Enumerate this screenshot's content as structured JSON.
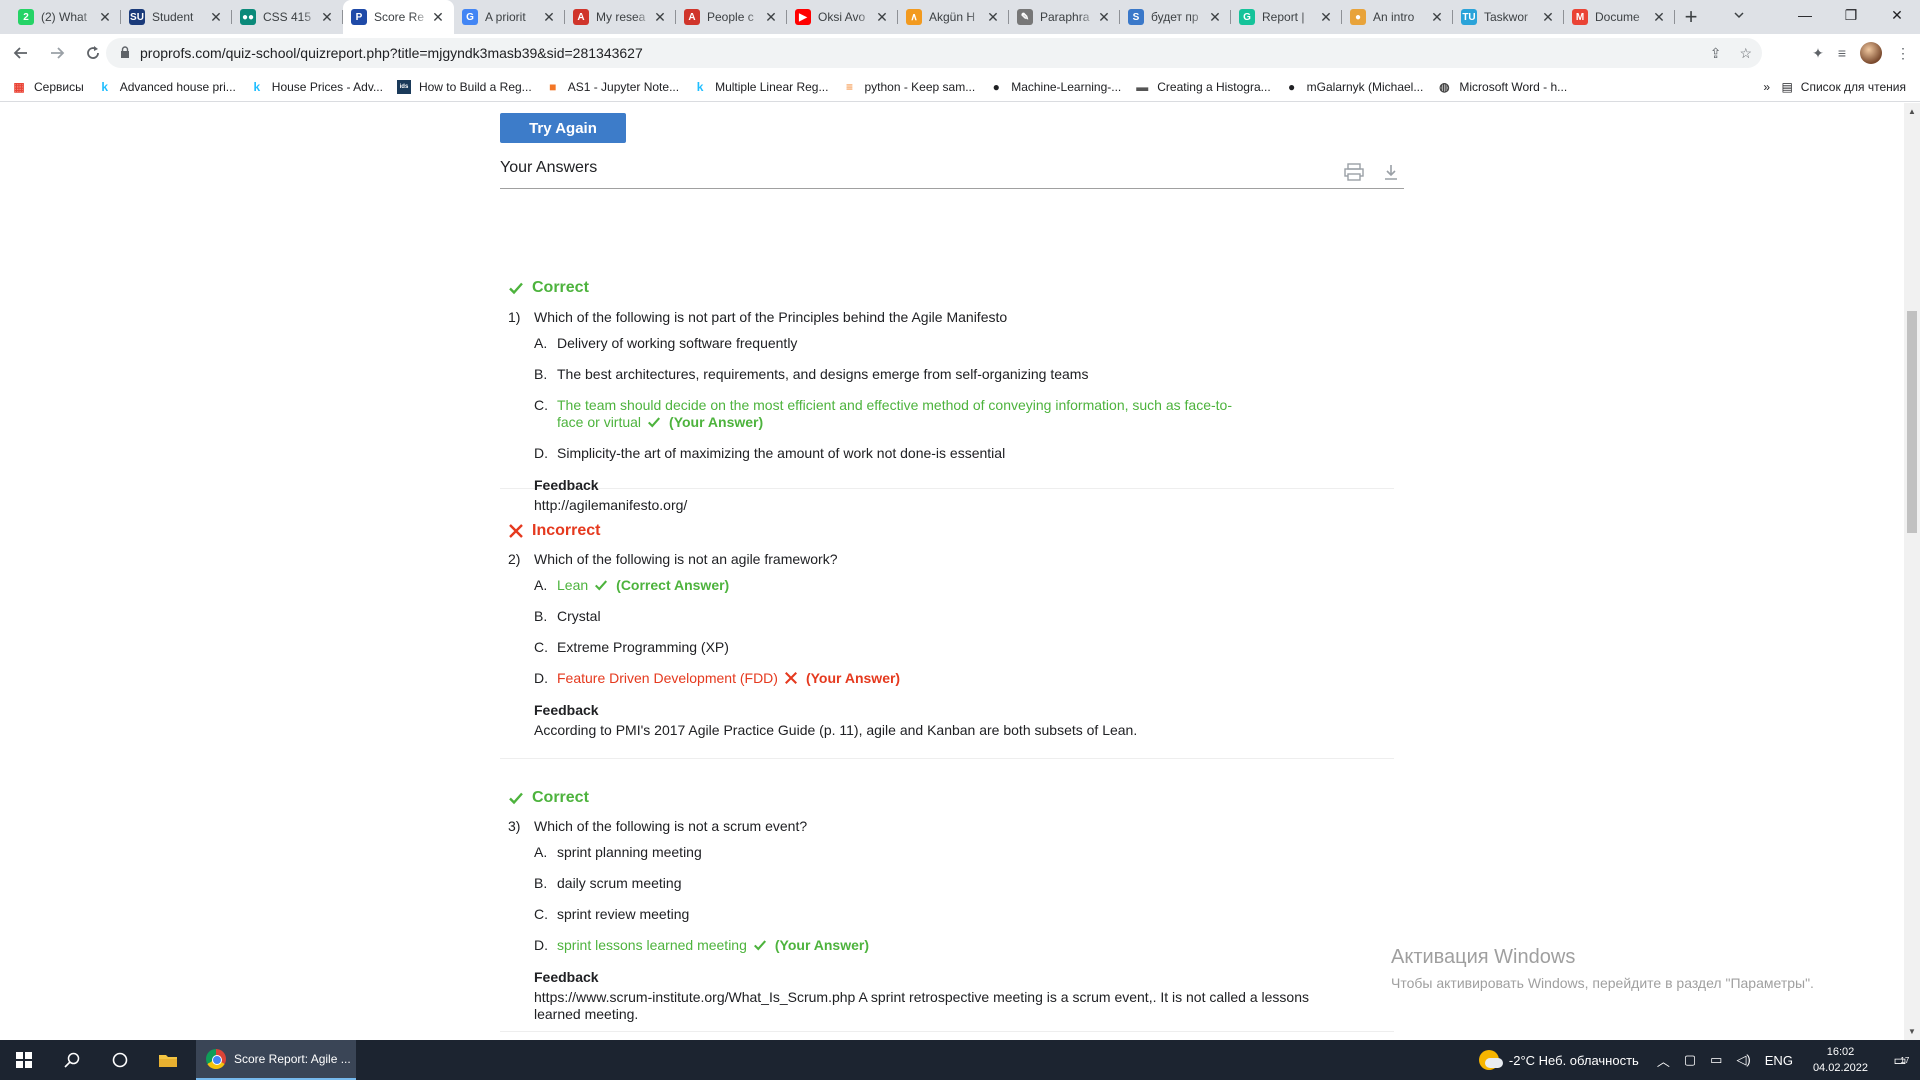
{
  "tabs": [
    {
      "title": "(2) What",
      "fav_text": "2",
      "fav_color": "#25d366",
      "active": false
    },
    {
      "title": "Student",
      "fav_text": "SU",
      "fav_color": "#1a3a7a",
      "active": false
    },
    {
      "title": "CSS 415",
      "fav_text": "●●",
      "fav_color": "#0b8a7a",
      "active": false
    },
    {
      "title": "Score Re",
      "fav_text": "P",
      "fav_color": "#1f4aa8",
      "active": true
    },
    {
      "title": "A priorit",
      "fav_text": "G",
      "fav_color": "#4285f4",
      "active": false
    },
    {
      "title": "My resea",
      "fav_text": "A",
      "fav_color": "#d0352b",
      "active": false
    },
    {
      "title": "People c",
      "fav_text": "A",
      "fav_color": "#d0352b",
      "active": false
    },
    {
      "title": "Oksi Avo",
      "fav_text": "▶",
      "fav_color": "#ff0000",
      "active": false
    },
    {
      "title": "Akgün H",
      "fav_text": "∧",
      "fav_color": "#f29a1f",
      "active": false
    },
    {
      "title": "Paraphra",
      "fav_text": "✎",
      "fav_color": "#777777",
      "active": false
    },
    {
      "title": "будет пр",
      "fav_text": "S",
      "fav_color": "#3a78c9",
      "active": false
    },
    {
      "title": "Report |",
      "fav_text": "G",
      "fav_color": "#15c39a",
      "active": false
    },
    {
      "title": "An intro",
      "fav_text": "●",
      "fav_color": "#e8a33a",
      "active": false
    },
    {
      "title": "Taskwor",
      "fav_text": "TU",
      "fav_color": "#2aa3d9",
      "active": false
    },
    {
      "title": "Docume",
      "fav_text": "M",
      "fav_color": "#ea4335",
      "active": false
    }
  ],
  "tab_close": "✕",
  "new_tab": "+",
  "window_controls": {
    "minimize": "—",
    "restore": "❐",
    "close": "✕"
  },
  "url": "proprofs.com/quiz-school/quizreport.php?title=mjgyndk3masb39&sid=281343627",
  "bookmarks": [
    {
      "label": "Сервисы",
      "icon": "▦",
      "color": "#ea4335"
    },
    {
      "label": "Advanced house pri...",
      "icon": "k",
      "color": "#20beff"
    },
    {
      "label": "House Prices - Adv...",
      "icon": "k",
      "color": "#20beff"
    },
    {
      "label": "How to Build a Reg...",
      "icon": "ids",
      "color": "#1a3a5a"
    },
    {
      "label": "AS1 - Jupyter Note...",
      "icon": "■",
      "color": "#f37626"
    },
    {
      "label": "Multiple Linear Reg...",
      "icon": "k",
      "color": "#20beff"
    },
    {
      "label": "python - Keep sam...",
      "icon": "≡",
      "color": "#f48024"
    },
    {
      "label": "Machine-Learning-...",
      "icon": "●",
      "color": "#202124"
    },
    {
      "label": "Creating a Histogra...",
      "icon": "▬",
      "color": "#555555"
    },
    {
      "label": "mGalarnyk (Michael...",
      "icon": "●",
      "color": "#202124"
    },
    {
      "label": "Microsoft Word - h...",
      "icon": "◍",
      "color": "#444444"
    }
  ],
  "bookmarks_more": "»",
  "reading_list": "Список для чтения",
  "try_again": "Try Again",
  "answers_title": "Your Answers",
  "questions": [
    {
      "status": "Correct",
      "number": "1)",
      "text": "Which of the following is not part of the Principles behind the Agile Manifesto",
      "options": [
        {
          "letter": "A.",
          "text": "Delivery of working software frequently",
          "tag": ""
        },
        {
          "letter": "B.",
          "text": "The best architectures, requirements, and designs emerge from self-organizing teams",
          "tag": ""
        },
        {
          "letter": "C.",
          "text": "The team should decide on the most efficient and effective method of conveying information, such as face-to-face or virtual",
          "tag": "(Your Answer)"
        },
        {
          "letter": "D.",
          "text": "Simplicity-the art of maximizing the amount of work not done-is essential",
          "tag": ""
        }
      ],
      "feedback_label": "Feedback",
      "feedback": "http://agilemanifesto.org/"
    },
    {
      "status": "Incorrect",
      "number": "2)",
      "text": "Which of the following is not an agile framework?",
      "options": [
        {
          "letter": "A.",
          "text": "Lean",
          "tag": "(Correct Answer)"
        },
        {
          "letter": "B.",
          "text": "Crystal",
          "tag": ""
        },
        {
          "letter": "C.",
          "text": "Extreme Programming (XP)",
          "tag": ""
        },
        {
          "letter": "D.",
          "text": "Feature Driven Development (FDD)",
          "tag": "(Your Answer)"
        }
      ],
      "feedback_label": "Feedback",
      "feedback": "According to PMI's 2017 Agile Practice Guide (p. 11), agile and Kanban are both subsets of Lean."
    },
    {
      "status": "Correct",
      "number": "3)",
      "text": "Which of the following is not a scrum event?",
      "options": [
        {
          "letter": "A.",
          "text": "sprint planning meeting",
          "tag": ""
        },
        {
          "letter": "B.",
          "text": "daily scrum meeting",
          "tag": ""
        },
        {
          "letter": "C.",
          "text": "sprint review meeting",
          "tag": ""
        },
        {
          "letter": "D.",
          "text": "sprint lessons learned meeting",
          "tag": "(Your Answer)"
        }
      ],
      "feedback_label": "Feedback",
      "feedback": "https://www.scrum-institute.org/What_Is_Scrum.php A sprint retrospective meeting is a scrum event,. It is not called a lessons learned meeting."
    }
  ],
  "colors": {
    "correct": "#4db33d",
    "incorrect": "#e5391e",
    "button": "#3d7cc9"
  },
  "windows_activation": {
    "title": "Активация Windows",
    "subtitle": "Чтобы активировать Windows, перейдите в раздел \"Параметры\"."
  },
  "taskbar": {
    "chrome_label": "Score Report: Agile ...",
    "weather": "-2°C  Неб. облачность",
    "language": "ENG",
    "time": "16:02",
    "date": "04.02.2022",
    "notifications": "17"
  }
}
